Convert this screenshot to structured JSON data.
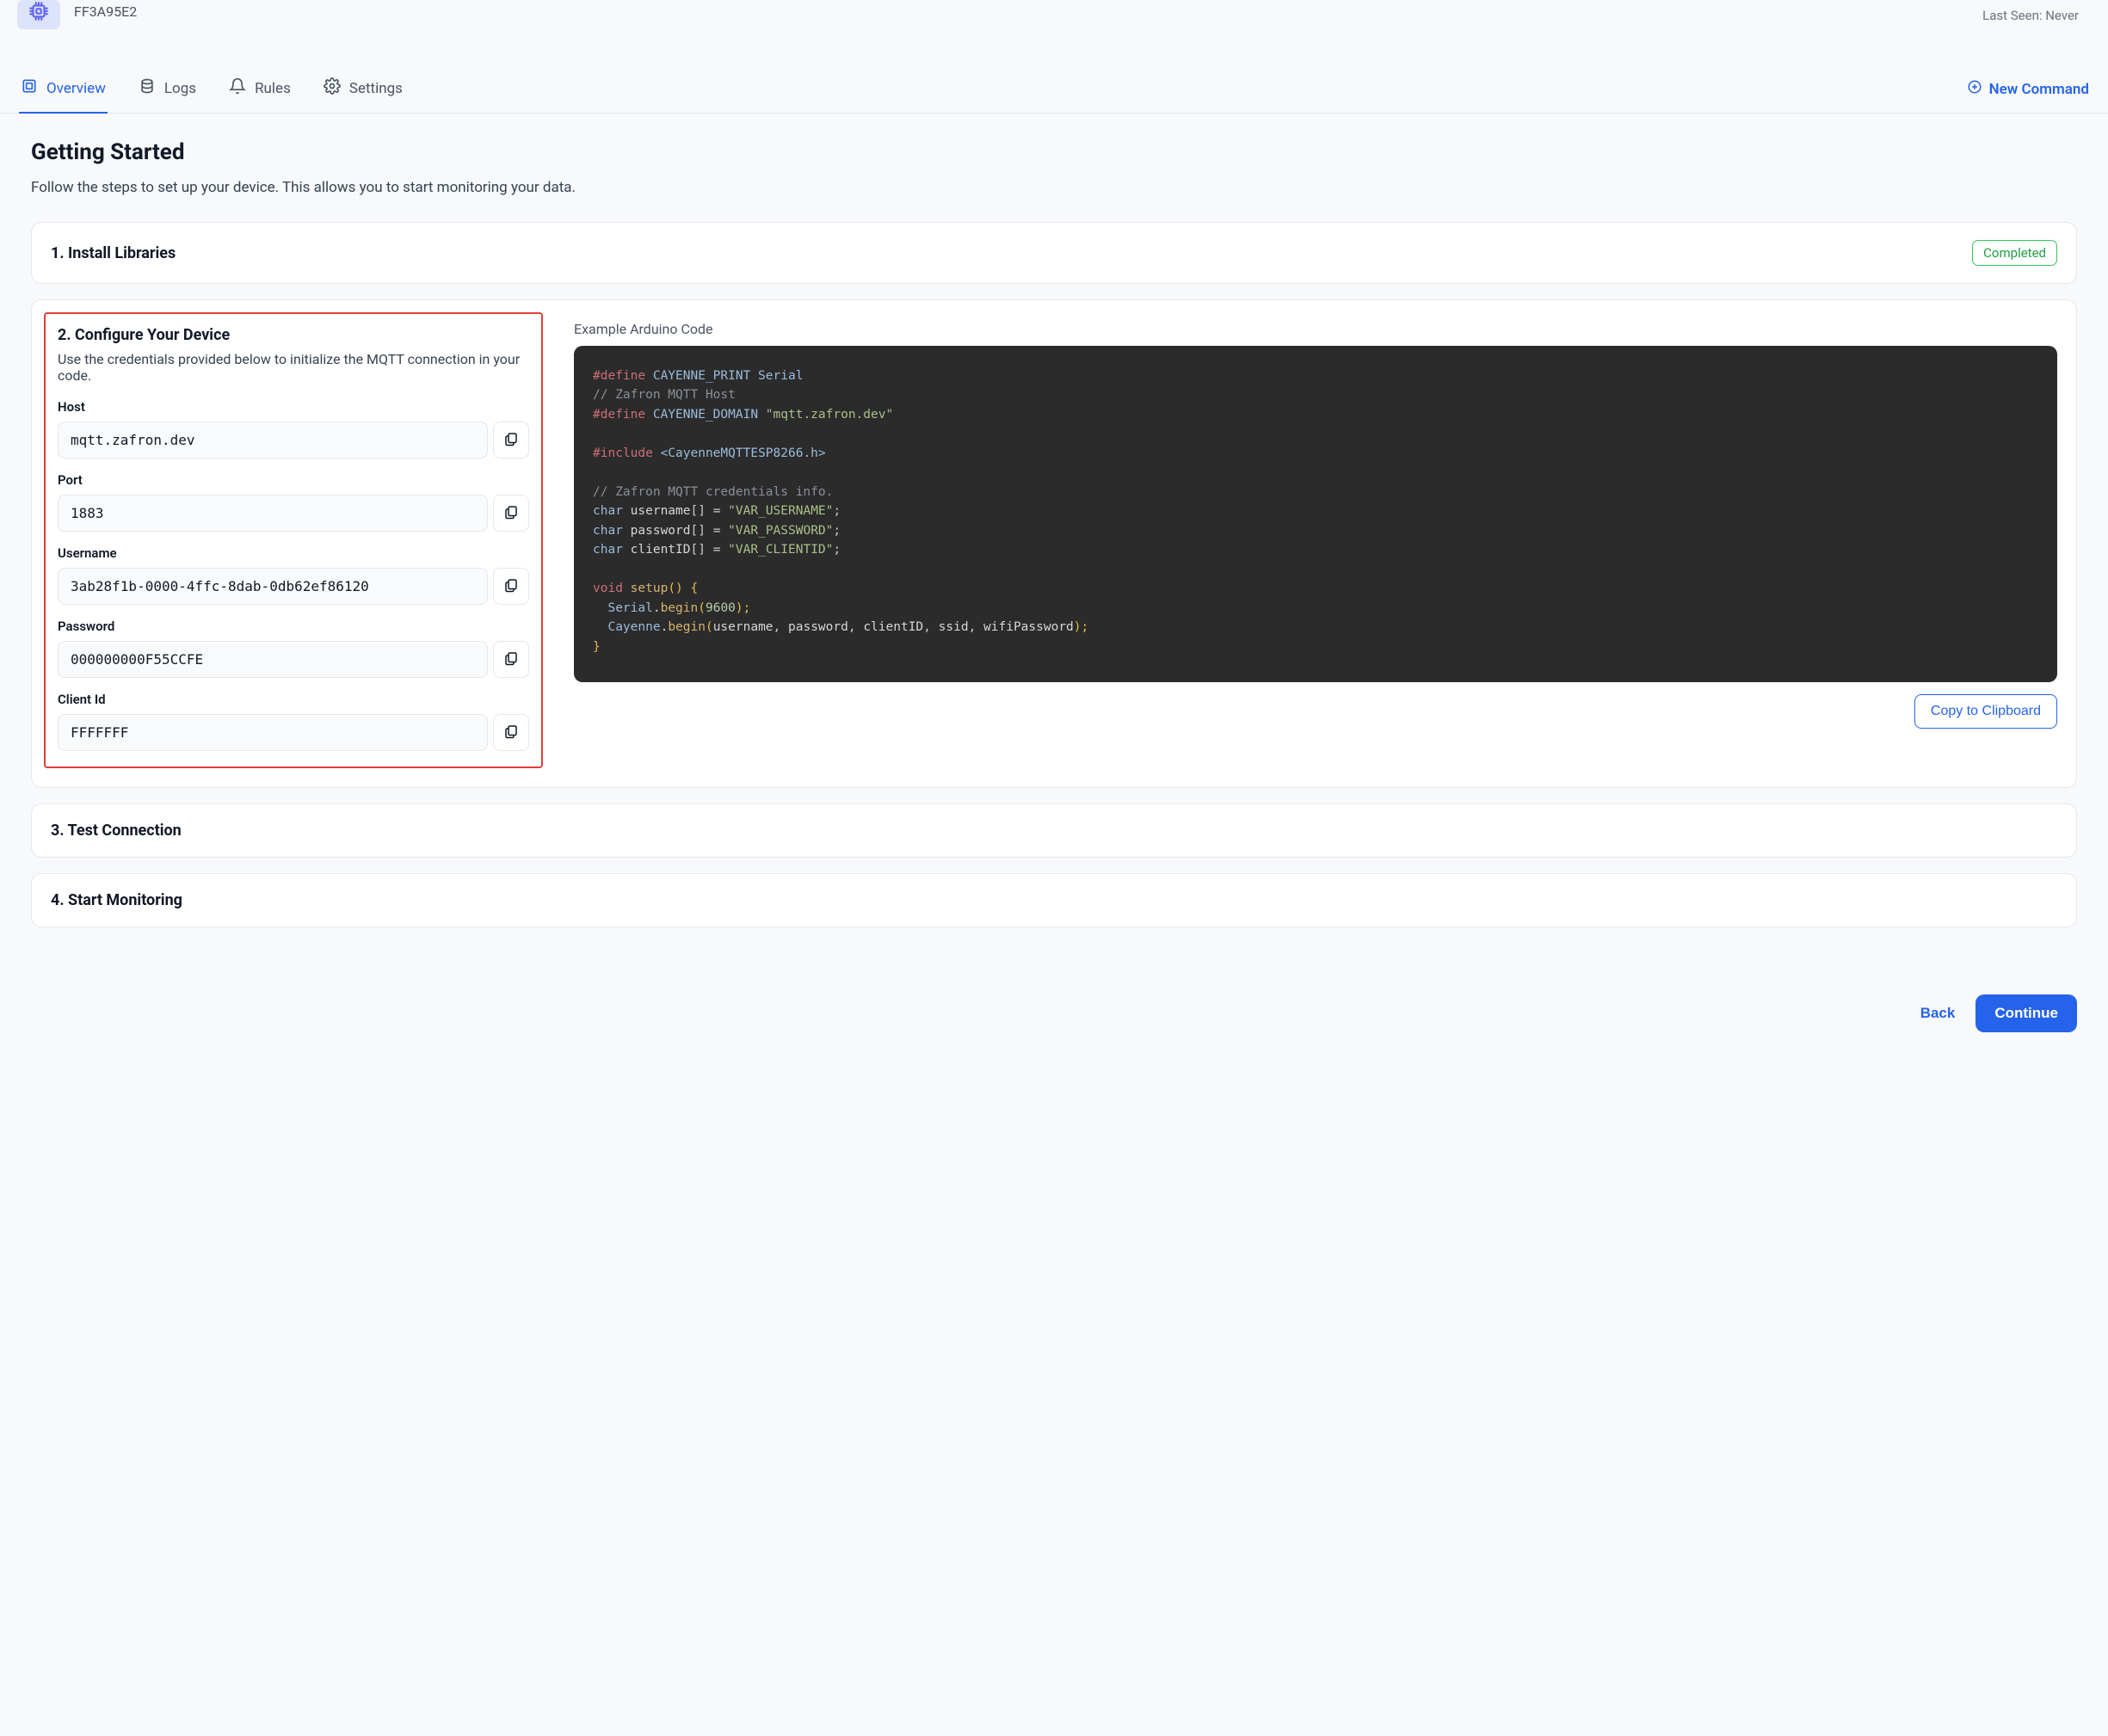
{
  "header": {
    "device_id": "FF3A95E2",
    "last_seen_label": "Last Seen: Never"
  },
  "tabs": {
    "overview": "Overview",
    "logs": "Logs",
    "rules": "Rules",
    "settings": "Settings"
  },
  "actions": {
    "new_command": "New Command",
    "back": "Back",
    "continue": "Continue",
    "copy_clipboard": "Copy to Clipboard"
  },
  "page": {
    "title": "Getting Started",
    "subtitle": "Follow the steps to set up your device. This allows you to start monitoring your data."
  },
  "step1": {
    "title": "1. Install Libraries",
    "status": "Completed"
  },
  "step2": {
    "title": "2. Configure Your Device",
    "desc": "Use the credentials provided below to initialize the MQTT connection in your code.",
    "fields": {
      "host": {
        "label": "Host",
        "value": "mqtt.zafron.dev"
      },
      "port": {
        "label": "Port",
        "value": "1883"
      },
      "username": {
        "label": "Username",
        "value": "3ab28f1b-0000-4ffc-8dab-0db62ef86120"
      },
      "password": {
        "label": "Password",
        "value": "000000000F55CCFE"
      },
      "clientid": {
        "label": "Client Id",
        "value": "FFFFFFF"
      }
    },
    "example_label": "Example Arduino Code",
    "code": {
      "define_kw": "#define",
      "cayenne_print": "CAYENNE_PRINT Serial",
      "comment_host": "// Zafron MQTT Host",
      "cayenne_domain": "CAYENNE_DOMAIN ",
      "cayenne_domain_val": "\"mqtt.zafron.dev\"",
      "include_kw": "#include",
      "include_val": "<CayenneMQTTESP8266.h>",
      "comment_creds": "// Zafron MQTT credentials info.",
      "char": "char",
      "username_var": "username",
      "username_val": "\"VAR_USERNAME\"",
      "password_var": "password",
      "password_val": "\"VAR_PASSWORD\"",
      "clientid_var": "clientID",
      "clientid_val": "\"VAR_CLIENTID\"",
      "void": "void",
      "setup": "setup",
      "serial": "Serial",
      "begin": "begin",
      "baud": "9600",
      "cayenne": "Cayenne",
      "arg_user": "username",
      "arg_pass": "password",
      "arg_cid": "clientID",
      "arg_ssid": "ssid",
      "arg_wifi": "wifiPassword",
      "brackets": "[]",
      "eq": " = ",
      "semi": ";",
      "paren_open_brace": "() {",
      "paren_open": "(",
      "paren_close_semi": ");",
      "comma": ", ",
      "brace_close": "}"
    }
  },
  "step3": {
    "title": "3. Test Connection"
  },
  "step4": {
    "title": "4. Start Monitoring"
  }
}
